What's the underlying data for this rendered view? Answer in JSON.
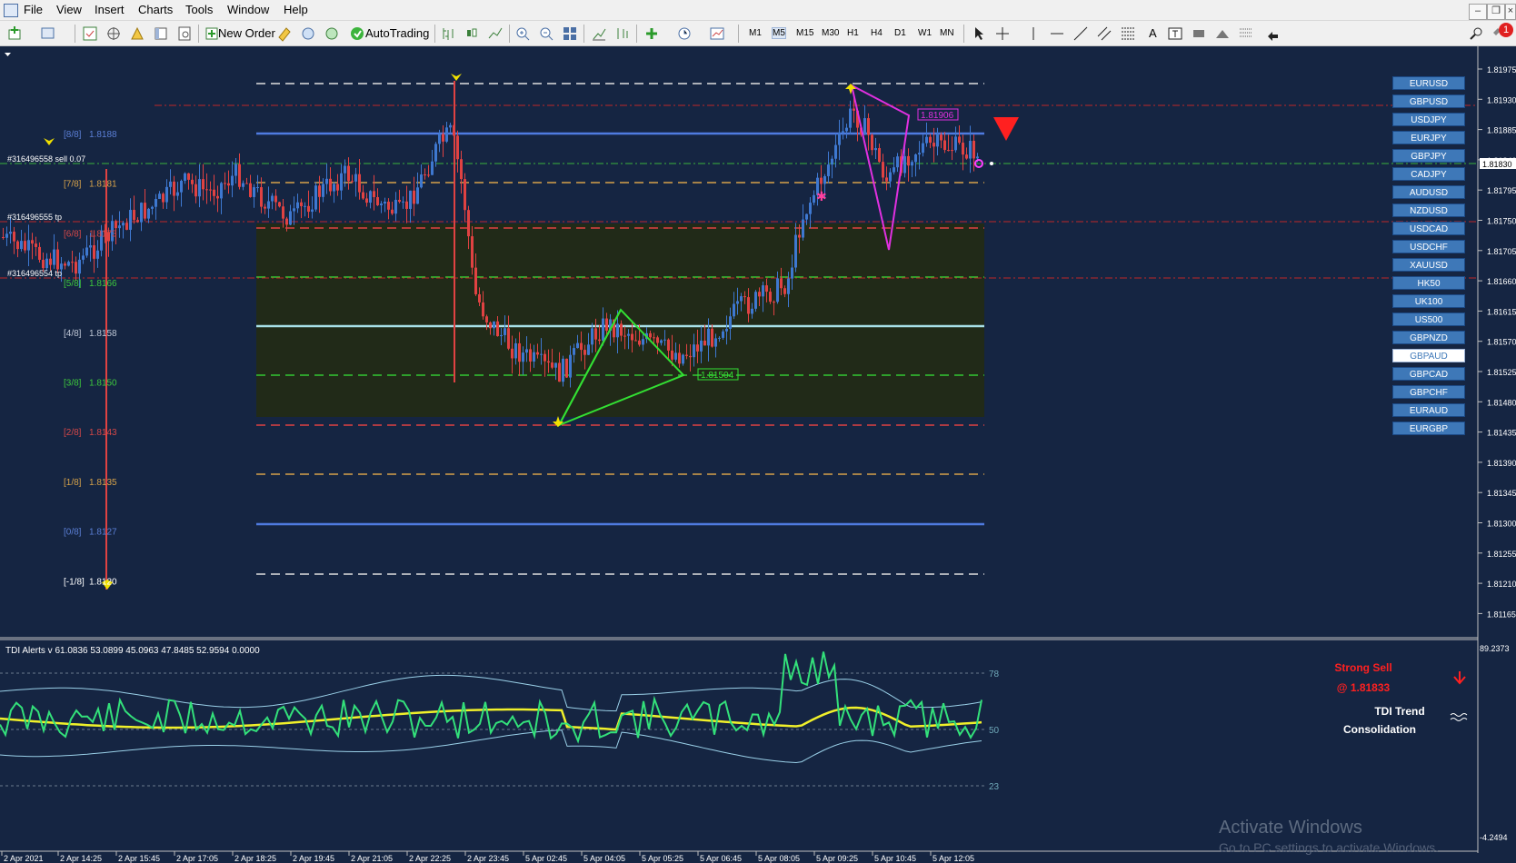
{
  "menubar": {
    "items": [
      "File",
      "View",
      "Insert",
      "Charts",
      "Tools",
      "Window",
      "Help"
    ],
    "notification_count": "1"
  },
  "toolbar": {
    "new_order_label": "New Order",
    "autotrading_label": "AutoTrading",
    "timeframes": [
      "M1",
      "M5",
      "M15",
      "M30",
      "H1",
      "H4",
      "D1",
      "W1",
      "MN"
    ],
    "active_timeframe": "M5"
  },
  "chart": {
    "price_axis": [
      "1.81975",
      "1.81930",
      "1.81885",
      "1.81840",
      "1.81795",
      "1.81750",
      "1.81705",
      "1.81660",
      "1.81615",
      "1.81570",
      "1.81525",
      "1.81480",
      "1.81435",
      "1.81390",
      "1.81345",
      "1.81300",
      "1.81255",
      "1.81210",
      "1.81165"
    ],
    "current_price": "1.81830",
    "time_axis": [
      "2 Apr 2021",
      "2 Apr 14:25",
      "2 Apr 15:45",
      "2 Apr 17:05",
      "2 Apr 18:25",
      "2 Apr 19:45",
      "2 Apr 21:05",
      "2 Apr 22:25",
      "2 Apr 23:45",
      "5 Apr 02:45",
      "5 Apr 04:05",
      "5 Apr 05:25",
      "5 Apr 06:45",
      "5 Apr 08:05",
      "5 Apr 09:25",
      "5 Apr 10:45",
      "5 Apr 12:05"
    ],
    "murrey_levels": [
      {
        "label": "[8/8]",
        "value": "1.8188",
        "color": "#5b7fd6"
      },
      {
        "label": "[7/8]",
        "value": "1.8181",
        "color": "#d6a24a"
      },
      {
        "label": "[6/8]",
        "value": "1.8173",
        "color": "#d64848"
      },
      {
        "label": "[5/8]",
        "value": "1.8166",
        "color": "#3dc83d"
      },
      {
        "label": "[4/8]",
        "value": "1.8158",
        "color": "#bfc7d6"
      },
      {
        "label": "[3/8]",
        "value": "1.8150",
        "color": "#3dc83d"
      },
      {
        "label": "[2/8]",
        "value": "1.8143",
        "color": "#d64848"
      },
      {
        "label": "[1/8]",
        "value": "1.8135",
        "color": "#d6a24a"
      },
      {
        "label": "[0/8]",
        "value": "1.8127",
        "color": "#5b7fd6"
      },
      {
        "label": "[-1/8]",
        "value": "1.8120",
        "color": "#ffffff"
      }
    ],
    "order_labels": [
      "#316496558 sell 0.07",
      "#316496555 tp",
      "#316496554 tp"
    ],
    "pattern_labels": {
      "magenta": "1.81906",
      "green": "1.81504"
    }
  },
  "symbols": {
    "items": [
      "EURUSD",
      "GBPUSD",
      "USDJPY",
      "EURJPY",
      "GBPJPY",
      "CADJPY",
      "AUDUSD",
      "NZDUSD",
      "USDCAD",
      "USDCHF",
      "XAUUSD",
      "HK50",
      "UK100",
      "US500",
      "GBPNZD",
      "GBPAUD",
      "GBPCAD",
      "GBPCHF",
      "EURAUD",
      "EURGBP"
    ],
    "active": "GBPAUD"
  },
  "indicator": {
    "header": "TDI Alerts v 61.0836 53.0899 45.0963 47.8485 52.9594 0.0000",
    "levels": [
      "78",
      "50",
      "23"
    ],
    "axis_top": "89.2373",
    "axis_bottom": "-4.2494",
    "signal": "Strong Sell",
    "signal_price": "@ 1.81833",
    "trend_title": "TDI Trend",
    "trend_state": "Consolidation"
  },
  "watermark": {
    "title": "Activate Windows",
    "subtitle": "Go to PC settings to activate Windows."
  },
  "colors": {
    "background": "#152542",
    "bull": "#3e78d0",
    "bear": "#e04242",
    "tdi_green": "#33e07a",
    "tdi_yellow": "#f0f02a",
    "band": "#9ad0e8",
    "signal": "#ff2020"
  }
}
